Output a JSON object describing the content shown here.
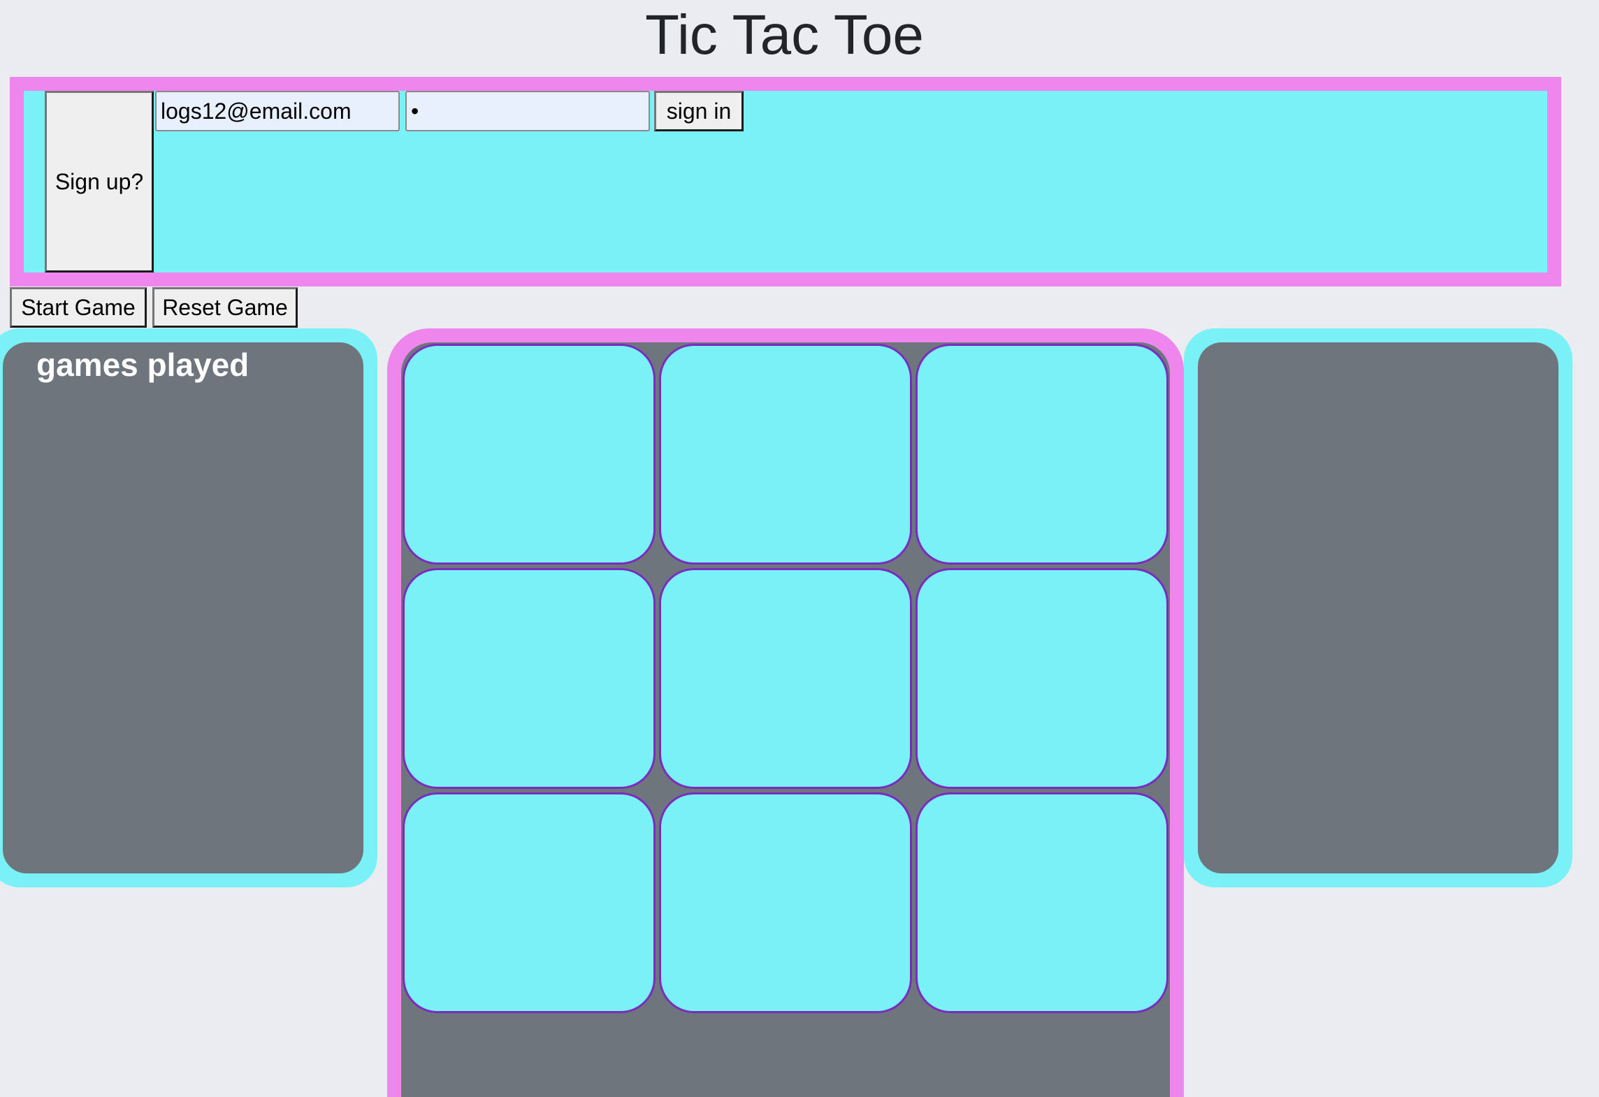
{
  "header": {
    "title": "Tic Tac Toe"
  },
  "auth": {
    "signup_label": "Sign up?",
    "email_value": "logs12@email.com",
    "password_value": "•",
    "signin_label": "sign in"
  },
  "controls": {
    "start_label": "Start Game",
    "reset_label": "Reset Game"
  },
  "stats_panel": {
    "heading": "games played"
  },
  "board": {
    "cells": [
      "",
      "",
      "",
      "",
      "",
      "",
      "",
      "",
      ""
    ]
  },
  "colors": {
    "accent_pink": "#ee86ee",
    "accent_cyan": "#7af1f6",
    "panel_gray": "#6f757d",
    "cell_border_purple": "#7b2bbf",
    "page_background": "#ebecf0"
  }
}
